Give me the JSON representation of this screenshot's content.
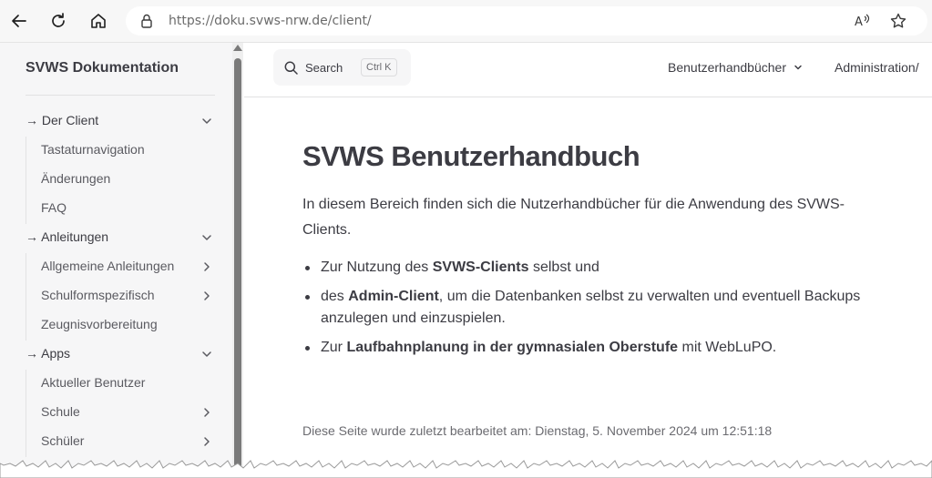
{
  "browser": {
    "url_host": "https://doku.svws-nrw.de",
    "url_path": "/client/"
  },
  "sidebar": {
    "title": "SVWS Dokumentation",
    "items": [
      {
        "label": "→ Der Client",
        "kind": "section",
        "chevron": "down"
      },
      {
        "label": "Tastaturnavigation",
        "kind": "sub",
        "chevron": ""
      },
      {
        "label": "Änderungen",
        "kind": "sub",
        "chevron": ""
      },
      {
        "label": "FAQ",
        "kind": "sub",
        "chevron": ""
      },
      {
        "label": "→ Anleitungen",
        "kind": "section",
        "chevron": "down"
      },
      {
        "label": "Allgemeine Anleitungen",
        "kind": "sub",
        "chevron": "right"
      },
      {
        "label": "Schulformspezifisch",
        "kind": "sub",
        "chevron": "right"
      },
      {
        "label": "Zeugnisvorbereitung",
        "kind": "sub",
        "chevron": ""
      },
      {
        "label": "→ Apps",
        "kind": "section",
        "chevron": "down"
      },
      {
        "label": "Aktueller Benutzer",
        "kind": "sub",
        "chevron": ""
      },
      {
        "label": "Schule",
        "kind": "sub",
        "chevron": "right"
      },
      {
        "label": "Schüler",
        "kind": "sub",
        "chevron": "right"
      }
    ]
  },
  "header": {
    "search_label": "Search",
    "search_shortcut": "Ctrl K",
    "nav_handbooks": "Benutzerhandbücher",
    "nav_admin": "Administration/"
  },
  "main": {
    "title": "SVWS Benutzerhandbuch",
    "intro": "In diesem Bereich finden sich die Nutzerhandbücher für die Anwendung des SVWS-Clients.",
    "bullets": [
      {
        "pre": "Zur Nutzung des ",
        "bold": "SVWS-Clients",
        "post": " selbst und"
      },
      {
        "pre": "des ",
        "bold": "Admin-Client",
        "post": ", um die Datenbanken selbst zu verwalten und eventuell Backups anzulegen und einzuspielen."
      },
      {
        "pre": "Zur ",
        "bold": "Laufbahnplanung in der gymnasialen Oberstufe",
        "post": " mit WebLuPO."
      }
    ],
    "last_edited": "Diese Seite wurde zuletzt bearbeitet am: Dienstag, 5. November 2024 um 12:51:18"
  }
}
